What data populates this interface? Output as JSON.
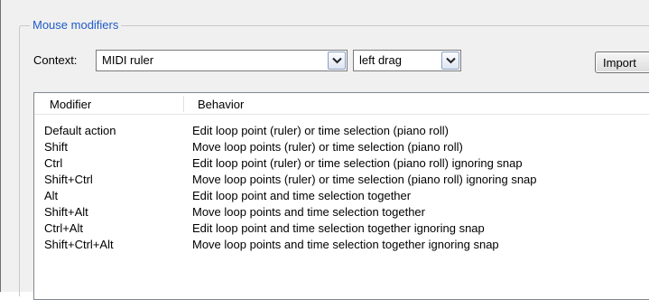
{
  "group": {
    "title": "Mouse modifiers"
  },
  "context": {
    "label": "Context:",
    "selected": "MIDI ruler",
    "action_selected": "left drag"
  },
  "buttons": {
    "import_label": "Import"
  },
  "list": {
    "columns": [
      "Modifier",
      "Behavior"
    ],
    "rows": [
      {
        "modifier": "Default action",
        "behavior": "Edit loop point (ruler) or time selection (piano roll)"
      },
      {
        "modifier": "Shift",
        "behavior": "Move loop points (ruler) or time selection (piano roll)"
      },
      {
        "modifier": "Ctrl",
        "behavior": "Edit loop point (ruler) or time selection (piano roll) ignoring snap"
      },
      {
        "modifier": "Shift+Ctrl",
        "behavior": "Move loop points (ruler) or time selection (piano roll) ignoring snap"
      },
      {
        "modifier": "Alt",
        "behavior": "Edit loop point and time selection together"
      },
      {
        "modifier": "Shift+Alt",
        "behavior": "Move loop points and time selection together"
      },
      {
        "modifier": "Ctrl+Alt",
        "behavior": "Edit loop point and time selection together ignoring snap"
      },
      {
        "modifier": "Shift+Ctrl+Alt",
        "behavior": "Move loop points and time selection together ignoring snap"
      }
    ]
  },
  "icons": {
    "dropdown": "chevron-down-icon"
  },
  "colors": {
    "group_title": "#1e5bc8",
    "dialog_bg": "#f0f0f0"
  }
}
